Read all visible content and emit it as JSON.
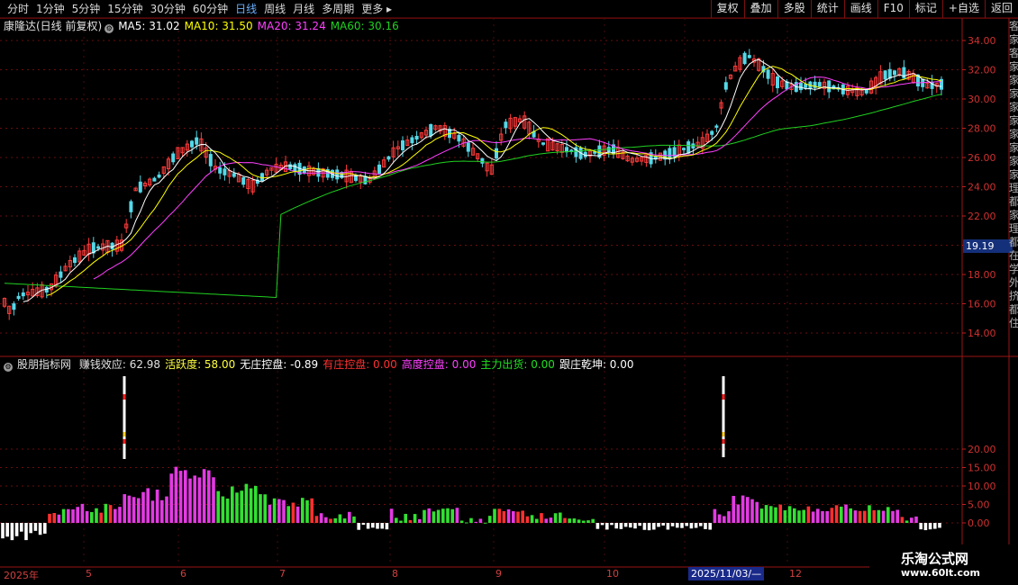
{
  "toolbar": {
    "periods": [
      "分时",
      "1分钟",
      "5分钟",
      "15分钟",
      "30分钟",
      "60分钟",
      "日线",
      "周线",
      "月线",
      "多周期",
      "更多"
    ],
    "active_index": 6,
    "right_tools": [
      "复权",
      "叠加",
      "多股",
      "统计",
      "画线",
      "F10",
      "标记",
      "+自选",
      "返回"
    ]
  },
  "main_legend": {
    "title": "康隆达(日线 前复权)",
    "ma5": "MA5: 31.02",
    "ma10": "MA10: 31.50",
    "ma20": "MA20: 31.24",
    "ma60": "MA60: 30.16",
    "colors": {
      "ma5": "#ffffff",
      "ma10": "#ffff00",
      "ma20": "#ff40ff",
      "ma60": "#20d020"
    }
  },
  "price_axis": {
    "ticks": [
      "34.00",
      "32.00",
      "30.00",
      "28.00",
      "26.00",
      "24.00",
      "22.00",
      "20.00",
      "18.00",
      "16.00",
      "14.00"
    ],
    "current_price": "19.19"
  },
  "indicator_legend": {
    "name": "股朋指标网",
    "items": [
      {
        "label": "赚钱效应: 62.98",
        "color": "#e0e0e0"
      },
      {
        "label": "活跃度: 58.00",
        "color": "#ffff40"
      },
      {
        "label": "无庄控盘: -0.89",
        "color": "#ffffff"
      },
      {
        "label": "有庄控盘: 0.00",
        "color": "#ff3030"
      },
      {
        "label": "高度控盘: 0.00",
        "color": "#ff40ff"
      },
      {
        "label": "主力出货: 0.00",
        "color": "#20e020"
      },
      {
        "label": "跟庄乾坤: 0.00",
        "color": "#ffffff"
      }
    ]
  },
  "indicator_axis": {
    "ticks": [
      "20.00",
      "15.00",
      "10.00",
      "5.00",
      "0.00"
    ]
  },
  "time_axis": {
    "labels": [
      "2025年",
      "5",
      "6",
      "7",
      "8",
      "9",
      "10",
      "12"
    ],
    "highlight": "2025/11/03/—"
  },
  "watermark": {
    "title": "乐淘公式网",
    "url": "www.60lt.com"
  },
  "side_text": "客家客家家家家家家家家家理都家理都在学外挤都住"
}
